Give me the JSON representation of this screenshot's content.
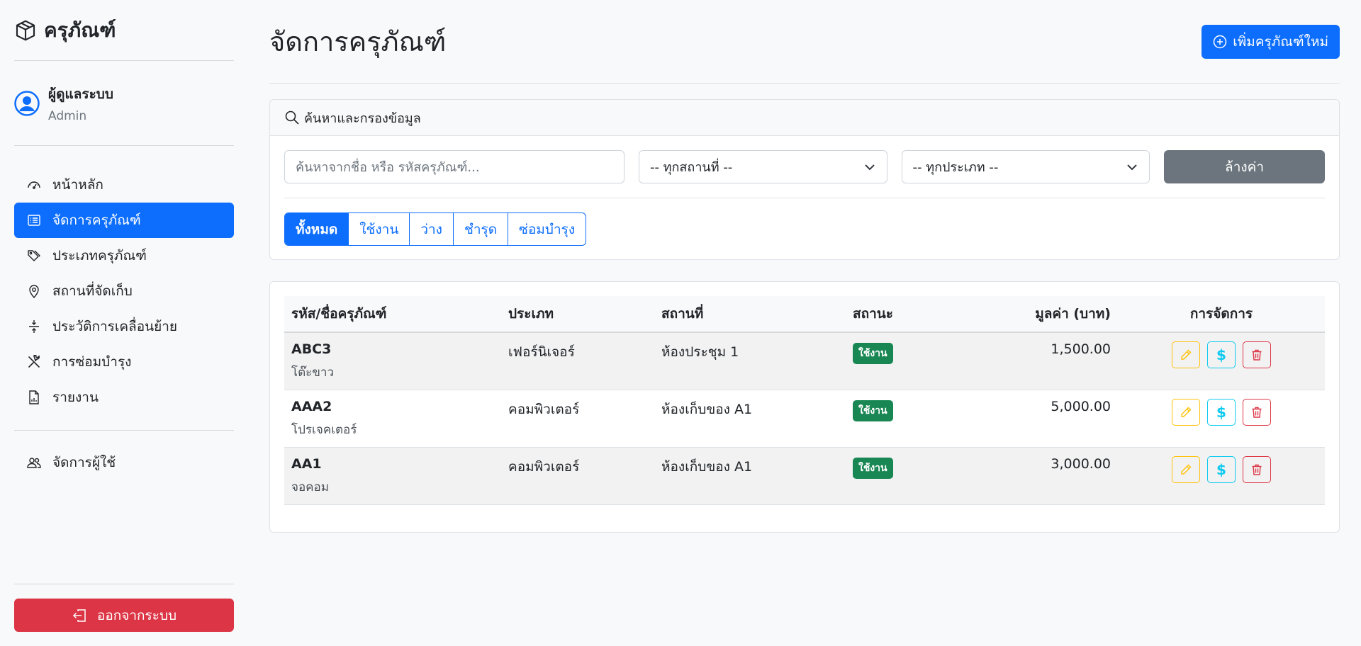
{
  "sidebar": {
    "brand": "ครุภัณฑ์",
    "user": {
      "name": "ผู้ดูแลระบบ",
      "role": "Admin"
    },
    "nav": [
      {
        "label": "หน้าหลัก",
        "icon": "dashboard-icon"
      },
      {
        "label": "จัดการครุภัณฑ์",
        "icon": "list-icon",
        "active": true
      },
      {
        "label": "ประเภทครุภัณฑ์",
        "icon": "tags-icon"
      },
      {
        "label": "สถานที่จัดเก็บ",
        "icon": "location-pin-icon"
      },
      {
        "label": "ประวัติการเคลื่อนย้าย",
        "icon": "move-icon"
      },
      {
        "label": "การซ่อมบำรุง",
        "icon": "tools-icon"
      },
      {
        "label": "รายงาน",
        "icon": "report-icon"
      }
    ],
    "admin_nav": [
      {
        "label": "จัดการผู้ใช้",
        "icon": "users-icon"
      }
    ],
    "logout": "ออกจากระบบ"
  },
  "header": {
    "title": "จัดการครุภัณฑ์",
    "add_button": "เพิ่มครุภัณฑ์ใหม่"
  },
  "filters": {
    "title": "ค้นหาและกรองข้อมูล",
    "search_placeholder": "ค้นหาจากชื่อ หรือ รหัสครุภัณฑ์...",
    "location_select": "-- ทุกสถานที่ --",
    "category_select": "-- ทุกประเภท --",
    "clear_button": "ล้างค่า",
    "tabs": [
      "ทั้งหมด",
      "ใช้งาน",
      "ว่าง",
      "ชำรุด",
      "ซ่อมบำรุง"
    ],
    "active_tab": "ทั้งหมด"
  },
  "table": {
    "columns": [
      "รหัส/ชื่อครุภัณฑ์",
      "ประเภท",
      "สถานที่",
      "สถานะ",
      "มูลค่า (บาท)",
      "การจัดการ"
    ],
    "rows": [
      {
        "code": "ABC3",
        "name": "โต๊ะขาว",
        "category": "เฟอร์นิเจอร์",
        "location": "ห้องประชุม 1",
        "status": "ใช้งาน",
        "value": "1,500.00"
      },
      {
        "code": "AAA2",
        "name": "โปรเจคเตอร์",
        "category": "คอมพิวเตอร์",
        "location": "ห้องเก็บของ A1",
        "status": "ใช้งาน",
        "value": "5,000.00"
      },
      {
        "code": "AA1",
        "name": "จอคอม",
        "category": "คอมพิวเตอร์",
        "location": "ห้องเก็บของ A1",
        "status": "ใช้งาน",
        "value": "3,000.00"
      }
    ]
  },
  "colors": {
    "primary": "#0d6efd",
    "danger": "#dc3545",
    "success": "#198754",
    "warning": "#ffc107",
    "info": "#0dcaf0",
    "secondary": "#6c757d"
  }
}
